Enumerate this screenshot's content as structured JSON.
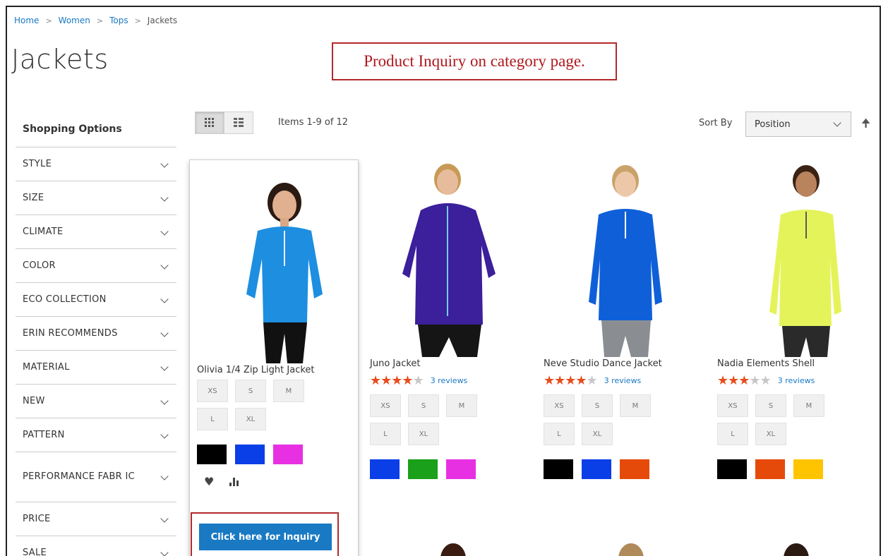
{
  "breadcrumb": [
    "Home",
    "Women",
    "Tops",
    "Jackets"
  ],
  "page_title": "Jackets",
  "annotation": "Product Inquiry on category page.",
  "sidebar": {
    "title": "Shopping Options",
    "filters": [
      {
        "label": "STYLE"
      },
      {
        "label": "SIZE"
      },
      {
        "label": "CLIMATE"
      },
      {
        "label": "COLOR"
      },
      {
        "label": "ECO COLLECTION"
      },
      {
        "label": "ERIN RECOMMENDS"
      },
      {
        "label": "MATERIAL"
      },
      {
        "label": "NEW"
      },
      {
        "label": "PATTERN"
      },
      {
        "label": "PERFORMANCE FABR IC"
      },
      {
        "label": "PRICE"
      },
      {
        "label": "SALE"
      }
    ]
  },
  "toolbar": {
    "items_count": "Items 1-9 of 12",
    "sort_label": "Sort By",
    "sort_value": "Position"
  },
  "products": [
    {
      "name": "Olivia 1/4 Zip Light Jacket",
      "rating": null,
      "reviews": "",
      "sizes": [
        "XS",
        "S",
        "M",
        "L",
        "XL"
      ],
      "colors": [
        "#000000",
        "#0a3fe8",
        "#e830e3"
      ],
      "inquiry_label": "Click here for Inquiry"
    },
    {
      "name": "Juno Jacket",
      "rating": 4.5,
      "reviews": "3 reviews",
      "sizes": [
        "XS",
        "S",
        "M",
        "L",
        "XL"
      ],
      "colors": [
        "#0a3fe8",
        "#1aa01a",
        "#e830e3"
      ]
    },
    {
      "name": "Neve Studio Dance Jacket",
      "rating": 4.5,
      "reviews": "3 reviews",
      "sizes": [
        "XS",
        "S",
        "M",
        "L",
        "XL"
      ],
      "colors": [
        "#000000",
        "#0a3fe8",
        "#e64a0a"
      ]
    },
    {
      "name": "Nadia Elements Shell",
      "rating": 3,
      "reviews": "3 reviews",
      "sizes": [
        "XS",
        "S",
        "M",
        "L",
        "XL"
      ],
      "colors": [
        "#000000",
        "#e64a0a",
        "#ffc400"
      ]
    }
  ]
}
